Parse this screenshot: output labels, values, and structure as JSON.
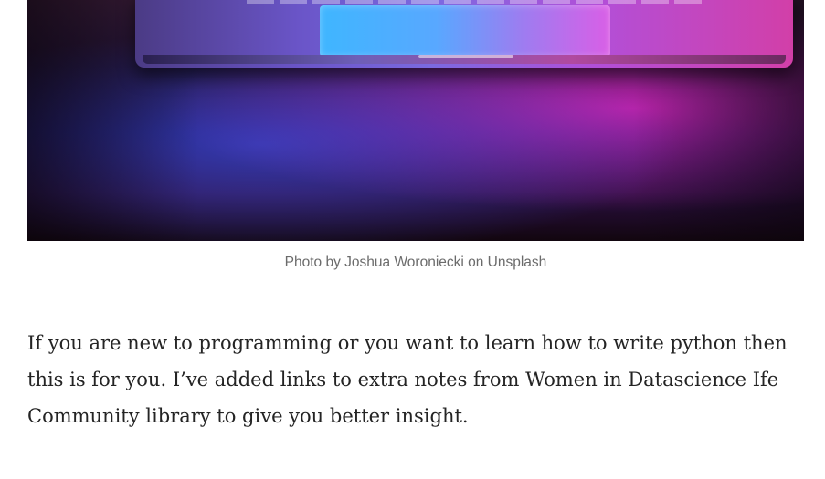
{
  "figure": {
    "image_alt": "Laptop illuminated by blue and pink light",
    "caption": "Photo by Joshua Woroniecki on Unsplash"
  },
  "article": {
    "paragraph": "If you are new to programming or you want to learn how to write python then this is for you. I’ve added links to extra notes from Women in Datascience Ife Community library to give you better insight."
  },
  "colors": {
    "caption_text": "#6b6b6b",
    "body_text": "#242424",
    "background": "#ffffff"
  }
}
